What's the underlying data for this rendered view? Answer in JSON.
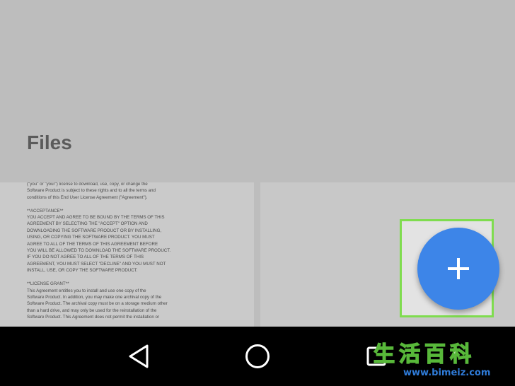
{
  "header": {
    "title": "Files"
  },
  "document": {
    "text": "(\"you\" or \"your\") license to download, use, copy, or change the\nSoftware Product is subject to these rights and to all the terms and\nconditions of this End User License Agreement (\"Agreement\").\n\n**ACCEPTANCE**\nYOU ACCEPT AND AGREE TO BE BOUND BY THE TERMS OF THIS\nAGREEMENT BY SELECTING THE \"ACCEPT\" OPTION AND\nDOWNLOADING THE SOFTWARE PRODUCT OR BY INSTALLING,\nUSING, OR COPYING THE SOFTWARE PRODUCT. YOU MUST\nAGREE TO ALL OF THE TERMS OF THIS AGREEMENT BEFORE\nYOU WILL BE ALLOWED TO DOWNLOAD THE SOFTWARE PRODUCT.\nIF YOU DO NOT AGREE TO ALL OF THE TERMS OF THIS\nAGREEMENT, YOU MUST SELECT \"DECLINE\" AND YOU MUST NOT\nINSTALL, USE, OR COPY THE SOFTWARE PRODUCT.\n\n**LICENSE GRANT**\nThis Agreement entitles you to install and use one copy of the\nSoftware Product. In addition, you may make one archival copy of the\nSoftware Product. The archival copy must be on a storage medium other\nthan a hard drive, and may only be used for the reinstallation of the\nSoftware Product. This Agreement does not permit the installation or"
  },
  "fab": {
    "icon": "plus-icon",
    "color": "#3d85e8"
  },
  "highlight_color": "#7fdc4f",
  "navbar": {
    "back_icon": "back-triangle-icon",
    "home_icon": "home-circle-icon",
    "recents_icon": "recents-square-icon"
  },
  "watermark": {
    "chinese": "生活百科",
    "url": "www.bimeiz.com"
  }
}
